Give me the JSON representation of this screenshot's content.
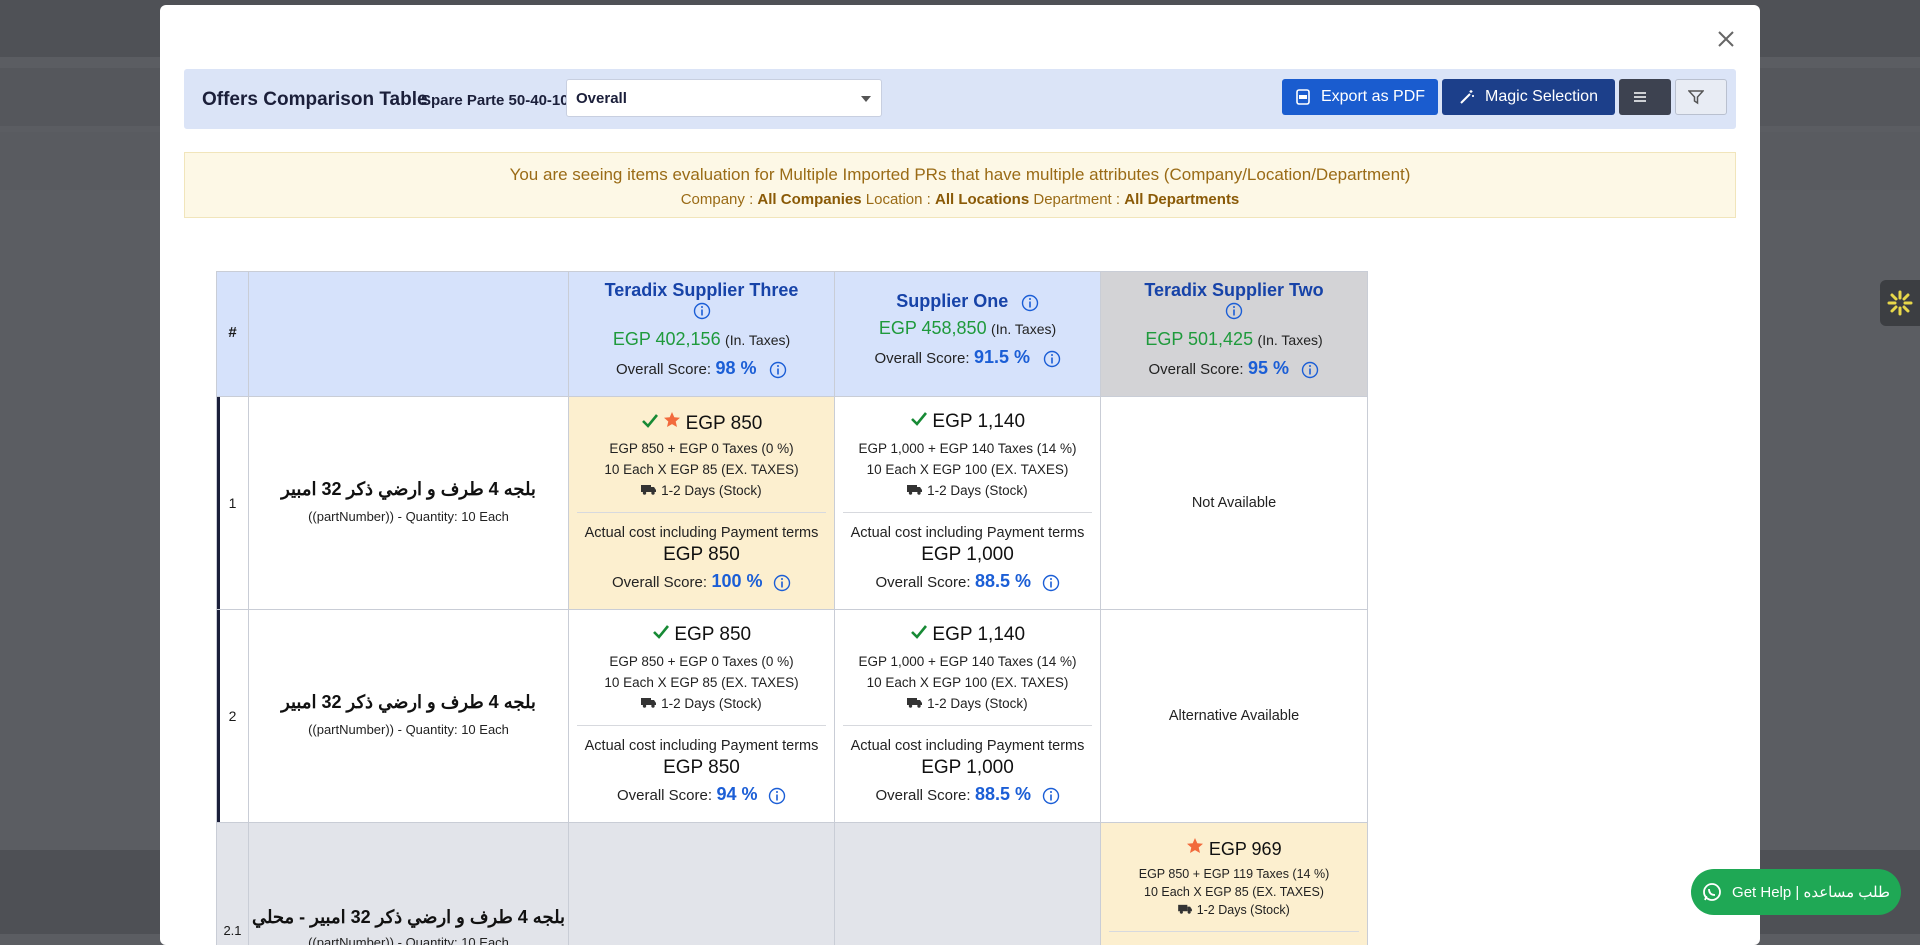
{
  "modal": {
    "close_icon": "close-icon"
  },
  "toolbar": {
    "title": "Offers Comparison Table",
    "subtitle": "Spare Parte 50-40-10",
    "view_select": "Overall",
    "export_label": "Export as PDF",
    "magic_label": "Magic Selection",
    "menu_icon": "menu-icon",
    "filter_icon": "filter-icon"
  },
  "notice": {
    "line1": "You are seeing items evaluation for Multiple Imported PRs that have multiple attributes (Company/Location/Department)",
    "company_label": "Company :",
    "company_value": "All Companies",
    "location_label": "Location :",
    "location_value": "All Locations",
    "department_label": "Department :",
    "department_value": "All Departments"
  },
  "table": {
    "hash_header": "#",
    "suppliers": [
      {
        "name": "Teradix Supplier Three",
        "total": "EGP 402,156",
        "tax_note": "(In. Taxes)",
        "score_label": "Overall Score:",
        "score": "98 %"
      },
      {
        "name": "Supplier One",
        "total": "EGP 458,850",
        "tax_note": "(In. Taxes)",
        "score_label": "Overall Score:",
        "score": "91.5 %"
      },
      {
        "name": "Teradix Supplier Two",
        "total": "EGP 501,425",
        "tax_note": "(In. Taxes)",
        "score_label": "Overall Score:",
        "score": "95 %"
      }
    ],
    "rows": [
      {
        "num": "1",
        "item": "بلجه 4 طرف و ارضي ذكر 32 امبير",
        "item_sub": "((partNumber)) - Quantity: 10 Each",
        "offers": [
          {
            "price": "EGP 850",
            "breakdown": "EGP 850 + EGP 0 Taxes (0 %)",
            "unit": "10 Each X EGP 85 (EX. TAXES)",
            "delivery": "1-2 Days (Stock)",
            "actual_label": "Actual cost including Payment terms",
            "actual": "EGP 850",
            "score_label": "Overall Score:",
            "score": "100 %"
          },
          {
            "price": "EGP 1,140",
            "breakdown": "EGP 1,000 + EGP 140 Taxes (14 %)",
            "unit": "10 Each X EGP 100 (EX. TAXES)",
            "delivery": "1-2 Days (Stock)",
            "actual_label": "Actual cost including Payment terms",
            "actual": "EGP 1,000",
            "score_label": "Overall Score:",
            "score": "88.5 %"
          },
          {
            "status": "Not Available"
          }
        ]
      },
      {
        "num": "2",
        "item": "بلجه 4 طرف و ارضي ذكر 32 امبير",
        "item_sub": "((partNumber)) - Quantity: 10 Each",
        "offers": [
          {
            "price": "EGP 850",
            "breakdown": "EGP 850 + EGP 0 Taxes (0 %)",
            "unit": "10 Each X EGP 85 (EX. TAXES)",
            "delivery": "1-2 Days (Stock)",
            "actual_label": "Actual cost including Payment terms",
            "actual": "EGP 850",
            "score_label": "Overall Score:",
            "score": "94 %"
          },
          {
            "price": "EGP 1,140",
            "breakdown": "EGP 1,000 + EGP 140 Taxes (14 %)",
            "unit": "10 Each X EGP 100 (EX. TAXES)",
            "delivery": "1-2 Days (Stock)",
            "actual_label": "Actual cost including Payment terms",
            "actual": "EGP 1,000",
            "score_label": "Overall Score:",
            "score": "88.5 %"
          },
          {
            "status": "Alternative Available"
          }
        ]
      },
      {
        "num": "2.1",
        "item": "بلجه 4 طرف و ارضي ذكر 32 امبير - محلي",
        "item_sub": "((partNumber)) - Quantity: 10 Each",
        "offers": [
          {},
          {},
          {
            "price": "EGP 969",
            "breakdown": "EGP 850 + EGP 119 Taxes (14 %)",
            "unit": "10 Each X EGP 85 (EX. TAXES)",
            "delivery": "1-2 Days (Stock)"
          }
        ]
      }
    ]
  },
  "help": {
    "label": "Get Help | طلب مساعده"
  },
  "colors": {
    "primary": "#1a5ccf",
    "magic": "#1c3f8a",
    "highlight": "#fcefcf",
    "header": "#d6e2fb",
    "green": "#1f9a3c",
    "help": "#1fa855"
  }
}
